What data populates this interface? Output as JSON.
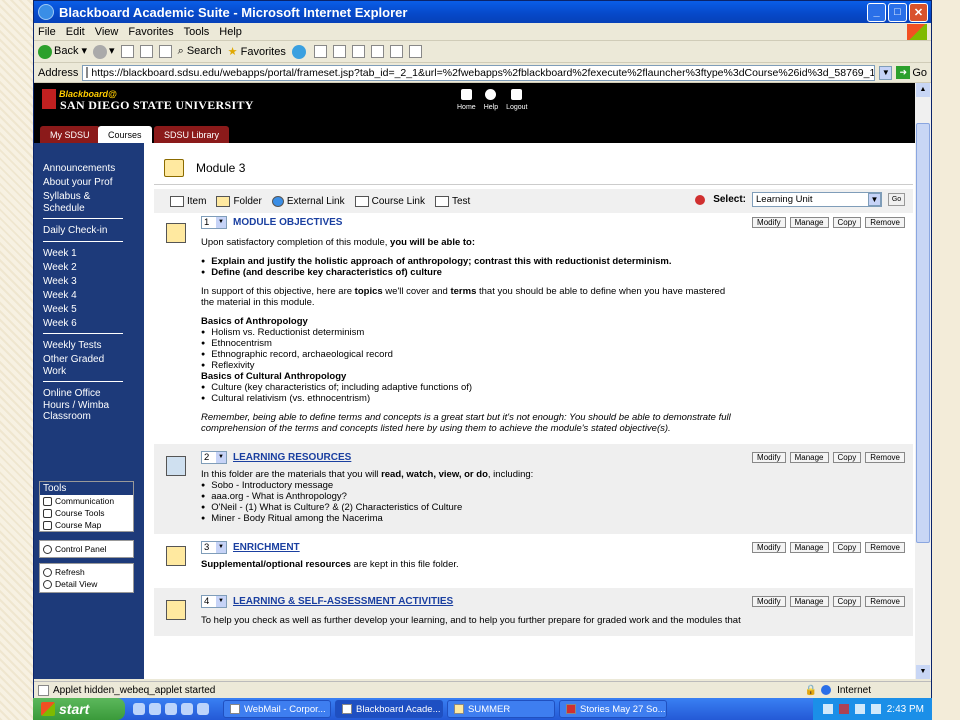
{
  "window": {
    "title": "Blackboard Academic Suite - Microsoft Internet Explorer",
    "buttons": {
      "minimize": "_",
      "maximize": "□",
      "close": "✕"
    }
  },
  "menu": [
    "File",
    "Edit",
    "View",
    "Favorites",
    "Tools",
    "Help"
  ],
  "toolbar": {
    "back": "Back",
    "search": "Search",
    "favorites": "Favorites"
  },
  "address": {
    "label": "Address",
    "url": "https://blackboard.sdsu.edu/webapps/portal/frameset.jsp?tab_id=_2_1&url=%2fwebapps%2fblackboard%2fexecute%2flauncher%3ftype%3dCourse%26id%3d_58769_1%26url%3d",
    "go": "Go"
  },
  "header": {
    "bb_logo": "Blackboard@",
    "university": "SAN DIEGO STATE UNIVERSITY",
    "icons": [
      "Home",
      "Help",
      "Logout"
    ]
  },
  "tabs": [
    "My SDSU",
    "Courses",
    "SDSU Library"
  ],
  "sidebar": {
    "groups": [
      [
        "Announcements",
        "About your Prof",
        "Syllabus & Schedule"
      ],
      [
        "Daily Check-in"
      ],
      [
        "Week 1",
        "Week 2",
        "Week 3",
        "Week 4",
        "Week 5",
        "Week 6"
      ],
      [
        "Weekly Tests",
        "Other Graded Work"
      ],
      [
        "Online Office Hours / Wimba Classroom"
      ]
    ],
    "tools": {
      "title": "Tools",
      "items": [
        "Communication",
        "Course Tools",
        "Course Map"
      ]
    },
    "control_panel": "Control Panel",
    "bottom": [
      "Refresh",
      "Detail View"
    ]
  },
  "module": {
    "title": "Module 3",
    "actions": [
      "Item",
      "Folder",
      "External Link",
      "Course Link",
      "Test"
    ],
    "select_label": "Select:",
    "select_value": "Learning Unit",
    "go": "Go"
  },
  "item_buttons": [
    "Modify",
    "Manage",
    "Copy",
    "Remove"
  ],
  "items": [
    {
      "num": "1",
      "title": "MODULE OBJECTIVES",
      "intro_a": "Upon satisfactory completion of this module, ",
      "intro_b": "you will be able to:",
      "objectives": [
        "Explain and justify the holistic approach of anthropology; contrast this with reductionist determinism.",
        "Define (and describe key characteristics of) culture"
      ],
      "support_a": "In support of this objective, here are ",
      "support_b": "topics",
      "support_c": " we'll cover and ",
      "support_d": "terms",
      "support_e": " that you should be able to define when you have mastered the material in this module.",
      "heading1": "Basics of Anthropology",
      "list1": [
        "Holism vs. Reductionist determinism",
        "Ethnocentrism",
        "Ethnographic record, archaeological record",
        "Reflexivity"
      ],
      "heading2": "Basics of Cultural Anthropology",
      "list2": [
        "Culture (key characteristics of; including adaptive functions of)",
        "Cultural relativism (vs. ethnocentrism)"
      ],
      "closing": "Remember, being able to define terms and concepts is a great start but it's not enough: You should be able to demonstrate full comprehension of the terms and concepts listed here by using them to achieve the module's stated objective(s)."
    },
    {
      "num": "2",
      "title": "LEARNING RESOURCES",
      "intro_a": "In this folder are the materials that you will ",
      "intro_b": "read, watch, view, or do",
      "intro_c": ", including:",
      "list": [
        "Sobo - Introductory message",
        "aaa.org - What is Anthropology?",
        "O'Neil - (1) What is Culture? & (2) Characteristics of Culture",
        "Miner - Body Ritual among the Nacerima"
      ]
    },
    {
      "num": "3",
      "title": "ENRICHMENT",
      "text_a": "Supplemental/optional resources",
      "text_b": " are kept in this file folder."
    },
    {
      "num": "4",
      "title": "LEARNING & SELF-ASSESSMENT ACTIVITIES",
      "text": "To help you check as well as further develop your learning, and to help you further prepare for graded work and the modules that"
    }
  ],
  "status": {
    "text": "Applet hidden_webeq_applet started",
    "zone": "Internet"
  },
  "taskbar": {
    "start": "start",
    "tasks": [
      "WebMail - Corpor...",
      "Blackboard Acade...",
      "SUMMER",
      "Stories May 27 So..."
    ],
    "clock": "2:43 PM"
  }
}
